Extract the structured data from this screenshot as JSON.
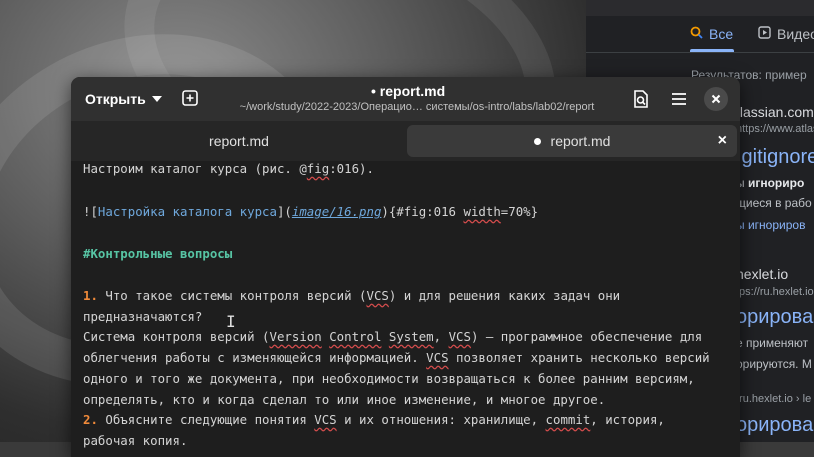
{
  "browser": {
    "tabs": [
      {
        "icon": "search-icon",
        "label": "Все",
        "active": true
      },
      {
        "icon": "play-icon",
        "label": "Видео",
        "active": false
      }
    ],
    "results_count": "Результатов: пример",
    "lines": {
      "site1": "tlassian.com",
      "url1": "https://www.atlas",
      "title1": ".gitignore",
      "snip1a": "ы",
      "snip1b": "игнориро",
      "snip2": "щиеся в рабо",
      "snip3": "ы игнориров",
      "site2": "hexlet.io",
      "url2": "tps://ru.hexlet.io",
      "title2": "орировани",
      "snip4": "е применяют",
      "snip5": "орируются. М",
      "url3": "/ru.hexlet.io › le",
      "title3": "орирован"
    }
  },
  "editor": {
    "open_label": "Открыть",
    "title": "• report.md",
    "path": "~/work/study/2022-2023/Операцио… системы/os-intro/labs/lab02/report",
    "tabs": [
      {
        "label": "report.md",
        "modified": false
      },
      {
        "label": "report.md",
        "modified": true
      }
    ],
    "lines": {
      "l1": "Настроим каталог курса (рис. @",
      "l1b": "fig",
      "l1c": ":016).",
      "l2a": "![",
      "l2b": "Настройка каталога курса",
      "l2c": "](",
      "l2d": "image/16.png",
      "l2e": "){#fig:016 ",
      "l2f": "width",
      "l2g": "=70%}",
      "heading": "#Контрольные вопросы",
      "q1num": "1.",
      "q1a": " Что такое системы контроля версий (",
      "q1b": "VCS",
      "q1c": ") и для решения каких задач они",
      "q1d": "предназначаются?",
      "a1a": "Система контроля версий (",
      "a1b": "Version",
      "a1c": " ",
      "a1d": "Control",
      "a1e": " ",
      "a1f": "System",
      "a1g": ", ",
      "a1h": "VCS",
      "a1i": ") — программное обеспечение для",
      "a2": "облегчения работы с изменяющейся информацией. ",
      "a2b": "VCS",
      "a2c": " позволяет хранить несколько версий",
      "a3": "одного и того же документа, при необходимости возвращаться к более ранним версиям,",
      "a4": "определять, кто и когда сделал то или иное изменение, и многое другое.",
      "q2num": "2.",
      "q2a": " Объясните следующие понятия ",
      "q2b": "VCS",
      "q2c": " и их отношения: хранилище, ",
      "q2d": "commit",
      "q2e": ", история,",
      "q2f": "рабочая копия."
    }
  }
}
